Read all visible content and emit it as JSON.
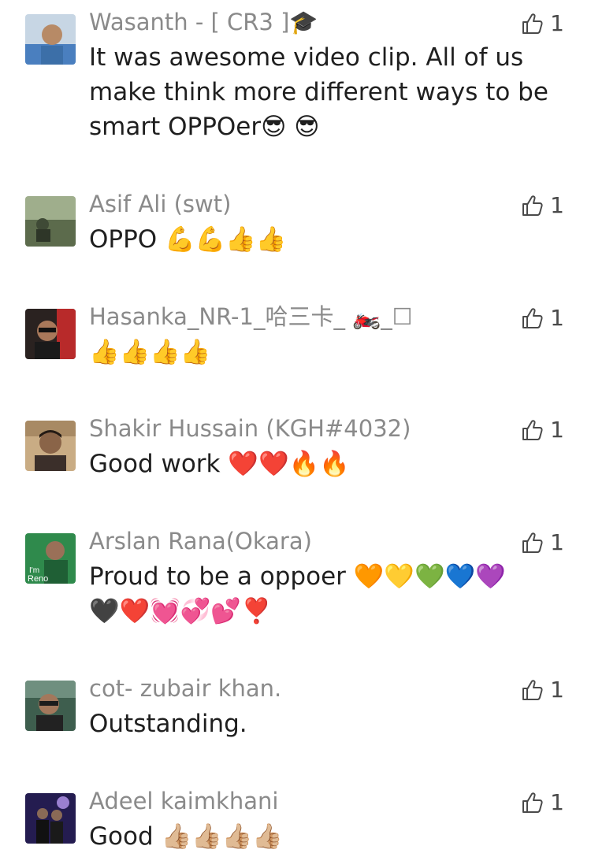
{
  "comments": [
    {
      "name": "Wasanth - [ CR3 ]🎓",
      "text": "It was awesome video clip. All of us make think more different ways to be smart OPPOer😎 😎",
      "likes": "1",
      "avatar_colors": [
        "#c7d6e4",
        "#3c6fa8"
      ]
    },
    {
      "name": "Asif Ali (swt)",
      "text": "OPPO 💪💪👍👍",
      "likes": "1",
      "avatar_colors": [
        "#7e8f6e",
        "#3f4a36"
      ]
    },
    {
      "name": "Hasanka_NR-1_哈三卡_ 🏍️_☐",
      "text": "👍👍👍👍",
      "likes": "1",
      "avatar_colors": [
        "#3a2d2a",
        "#c03030"
      ]
    },
    {
      "name": "Shakir Hussain (KGH#4032)",
      "text": "Good work ❤️❤️🔥🔥",
      "likes": "1",
      "avatar_colors": [
        "#b99a78",
        "#3b2f2a"
      ]
    },
    {
      "name": "Arslan Rana(Okara)",
      "text": "Proud to be a oppoer 🧡💛💚💙💜\n🖤❤️💓💞💕❣️",
      "likes": "1",
      "avatar_colors": [
        "#2f8a4c",
        "#e8e2dc"
      ]
    },
    {
      "name": "cot- zubair khan.",
      "text": "Outstanding.",
      "likes": "1",
      "avatar_colors": [
        "#47705c",
        "#2a2a2a"
      ]
    },
    {
      "name": "Adeel kaimkhani",
      "text": "Good 👍🏼👍🏼👍🏼👍🏼",
      "likes": "1",
      "avatar_colors": [
        "#2d235e",
        "#9a7fd0"
      ]
    }
  ],
  "avatar_text": "I'm\nReno"
}
